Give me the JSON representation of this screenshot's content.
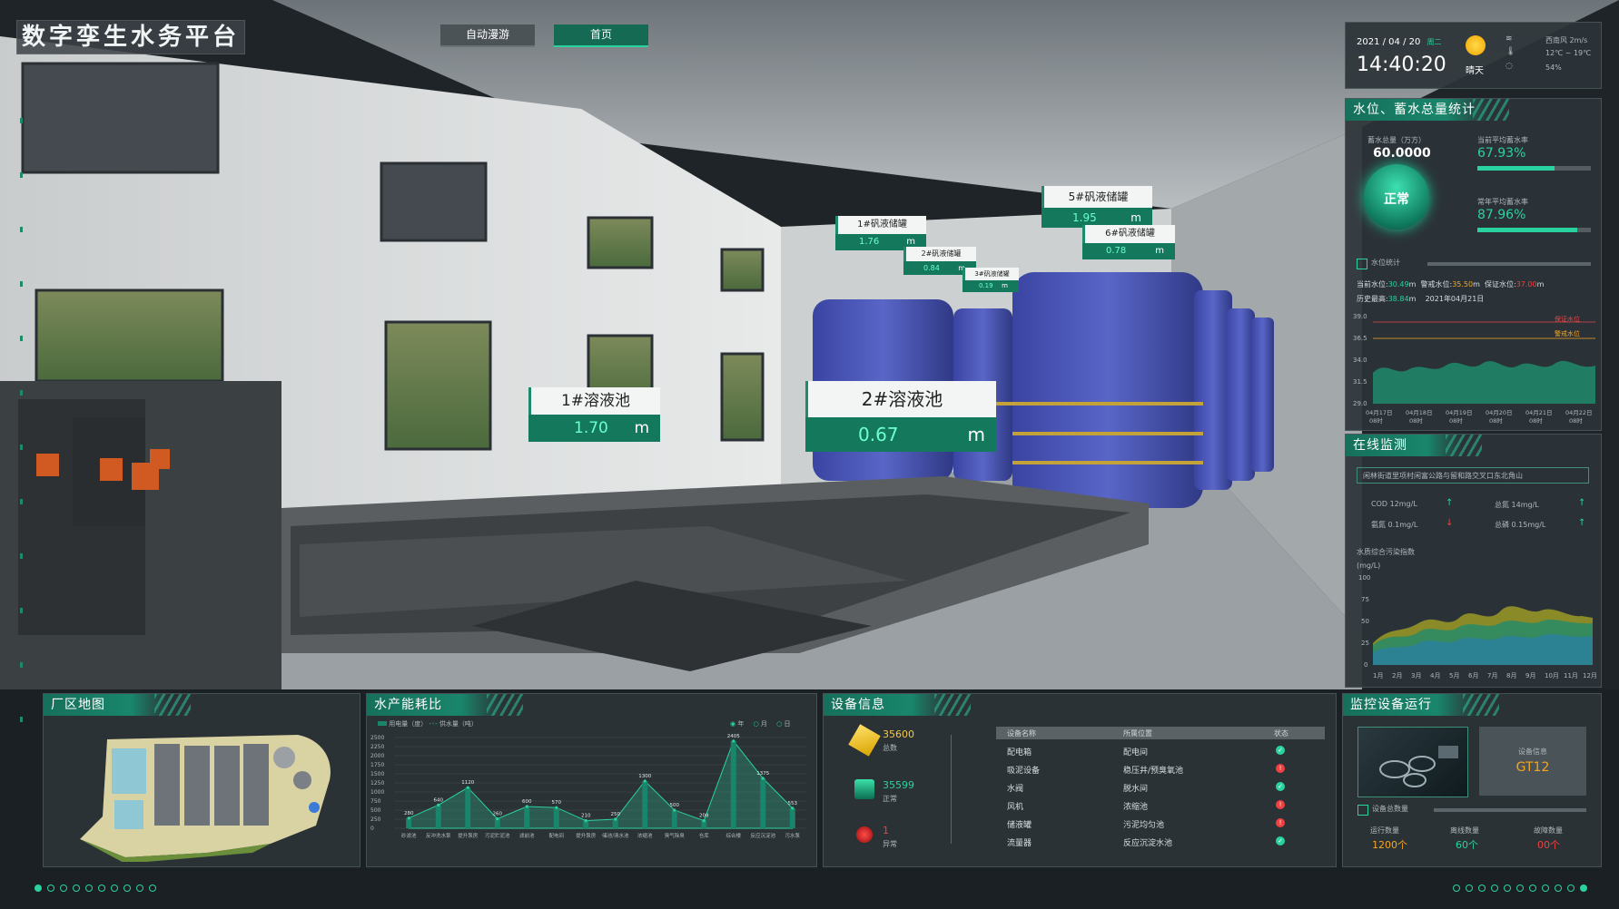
{
  "header": {
    "title": "数字孪生水务平台",
    "nav": [
      {
        "label": "自动漫游",
        "active": false
      },
      {
        "label": "首页",
        "active": true
      }
    ]
  },
  "weather": {
    "date": "2021 / 04 / 20",
    "weekday": "周二",
    "time": "14:40:20",
    "condition": "晴天",
    "wind": "西南风 2m/s",
    "temperature": "12℃ ~ 19℃",
    "humidity": "54%"
  },
  "scene_labels": [
    {
      "name": "1#溶液池",
      "value": "1.70",
      "unit": "m"
    },
    {
      "name": "2#溶液池",
      "value": "0.67",
      "unit": "m"
    },
    {
      "name": "1#矾液储罐",
      "value": "1.76",
      "unit": "m"
    },
    {
      "name": "2#矾液储罐",
      "value": "0.84",
      "unit": "m"
    },
    {
      "name": "3#矾液储罐",
      "value": "0.19",
      "unit": "m"
    },
    {
      "name": "5#矾液储罐",
      "value": "1.95",
      "unit": "m"
    },
    {
      "name": "6#矾液储罐",
      "value": "0.78",
      "unit": "m"
    }
  ],
  "water_level": {
    "title": "水位、蓄水总量统计",
    "storage_label": "蓄水总量（万方）",
    "storage_value": "60.0000",
    "status": "正常",
    "current_avg_label": "当前平均蓄水率",
    "current_avg_value": "67.93%",
    "current_avg_ratio": 0.6793,
    "yearly_avg_label": "常年平均蓄水率",
    "yearly_avg_value": "87.96%",
    "yearly_avg_ratio": 0.8796,
    "section_label": "水位统计",
    "current_label": "当前水位:",
    "current_value": "30.49",
    "warn_label": "警戒水位:",
    "warn_value": "35.50",
    "guarantee_label": "保证水位:",
    "guarantee_value": "37.00",
    "hist_label": "历史最高:",
    "hist_value": "38.84",
    "hist_date": "2021年04月21日",
    "unit": "m",
    "legend_guarantee": "保证水位",
    "legend_warn": "警戒水位",
    "y_ticks": [
      "39.0",
      "36.5",
      "34.0",
      "31.5",
      "29.0"
    ],
    "x_ticks": [
      {
        "d": "04月17日",
        "t": "08时"
      },
      {
        "d": "04月18日",
        "t": "08时"
      },
      {
        "d": "04月19日",
        "t": "08时"
      },
      {
        "d": "04月20日",
        "t": "08时"
      },
      {
        "d": "04月21日",
        "t": "08时"
      },
      {
        "d": "04月22日",
        "t": "08时"
      }
    ]
  },
  "online": {
    "title": "在线监测",
    "location": "闲林街道里项村闲富公路与留和路交叉口东北角山",
    "items": [
      {
        "label": "COD 12mg/L",
        "trend": "up"
      },
      {
        "label": "总氮 14mg/L",
        "trend": "up"
      },
      {
        "label": "氨氮 0.1mg/L",
        "trend": "down"
      },
      {
        "label": "总磷 0.15mg/L",
        "trend": "up"
      }
    ],
    "chart_title": "水质综合污染指数",
    "unit": "(mg/L)",
    "y_ticks": [
      "100",
      "75",
      "50",
      "25",
      "0"
    ],
    "months": [
      "1月",
      "2月",
      "3月",
      "4月",
      "5月",
      "6月",
      "7月",
      "8月",
      "9月",
      "10月",
      "11月",
      "12月"
    ]
  },
  "plant_map": {
    "title": "厂区地图"
  },
  "energy": {
    "title": "水产能耗比",
    "legend_power": "用电量（度）",
    "legend_water": "供水量（吨）",
    "period_day": "年",
    "period_month": "月",
    "period_week": "日",
    "y_ticks": [
      "2500",
      "2250",
      "2000",
      "1750",
      "1500",
      "1250",
      "1000",
      "750",
      "500",
      "250",
      "0"
    ]
  },
  "chart_data": {
    "type": "bar",
    "title": "水产能耗比",
    "categories": [
      "砂滤池",
      "反冲洗水泵",
      "提升泵房",
      "污泥贮泥池",
      "滤前池",
      "配电间",
      "提升泵房",
      "储池/清水池",
      "浓缩池",
      "臭气除臭",
      "仓库",
      "综合楼",
      "反应沉淀池",
      "污水泵"
    ],
    "series": [
      {
        "name": "用电量（度）",
        "values": [
          280,
          640,
          1120,
          260,
          600,
          570,
          210,
          250,
          1300,
          500,
          209,
          2405,
          1375,
          553
        ]
      }
    ],
    "ylim": [
      0,
      2500
    ]
  },
  "device": {
    "title": "设备信息",
    "total_value": "35600",
    "total_label": "总数",
    "normal_value": "35599",
    "normal_label": "正常",
    "abnormal_value": "1",
    "abnormal_label": "异常",
    "col_name": "设备名称",
    "col_loc": "所属位置",
    "col_status": "状态",
    "rows": [
      {
        "name": "配电箱",
        "loc": "配电间",
        "ok": true
      },
      {
        "name": "吸泥设备",
        "loc": "稳压井/预臭氧池",
        "ok": false
      },
      {
        "name": "水阀",
        "loc": "脱水间",
        "ok": true
      },
      {
        "name": "风机",
        "loc": "浓缩池",
        "ok": false
      },
      {
        "name": "储液罐",
        "loc": "污泥均匀池",
        "ok": false
      },
      {
        "name": "流量器",
        "loc": "反应沉淀水池",
        "ok": true
      }
    ]
  },
  "monitor": {
    "title": "监控设备运行",
    "info_label": "设备信息",
    "info_value": "GT12",
    "section_label": "设备总数量",
    "running_label": "运行数量",
    "running_value": "1200个",
    "offline_label": "离线数量",
    "offline_value": "60个",
    "fault_label": "故障数量",
    "fault_value": "00个"
  },
  "colors": {
    "accent": "#19866b",
    "bright": "#2ad29f",
    "warn": "#f5a623",
    "danger": "#f04040"
  }
}
